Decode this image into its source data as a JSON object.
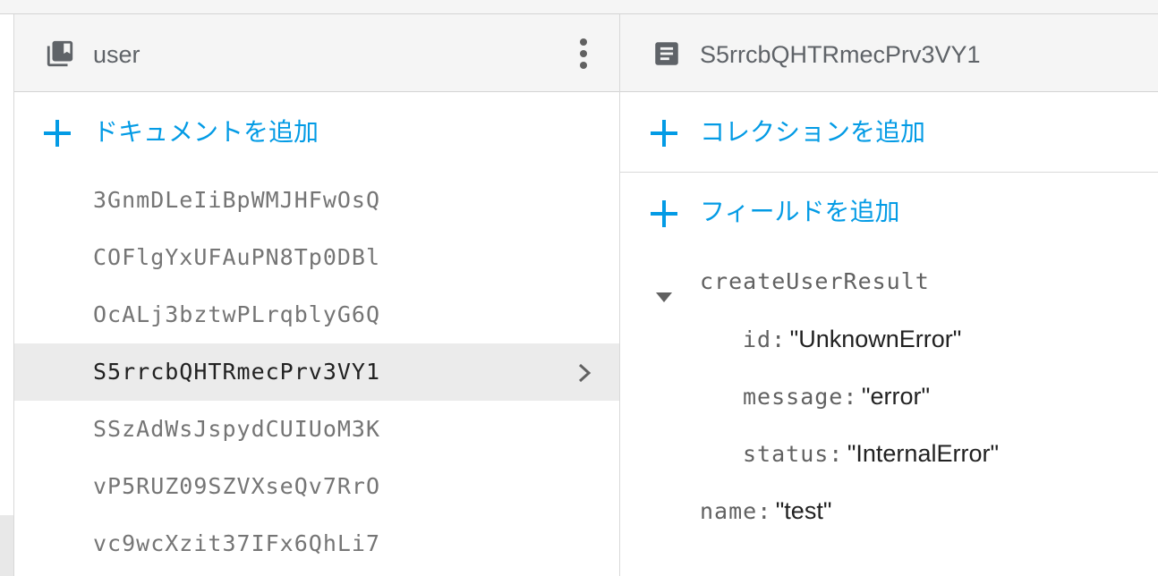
{
  "collection": {
    "name": "user",
    "add_document_label": "ドキュメントを追加",
    "documents": [
      "3GnmDLeIiBpWMJHFwOsQ",
      "COFlgYxUFAuPN8Tp0DBl",
      "OcALj3bztwPLrqblyG6Q",
      "S5rrcbQHTRmecPrv3VY1",
      "SSzAdWsJspydCUIUoM3K",
      "vP5RUZ09SZVXseQv7RrO",
      "vc9wcXzit37IFx6QhLi7"
    ],
    "selected_index": 3
  },
  "document": {
    "id": "S5rrcbQHTRmecPrv3VY1",
    "add_collection_label": "コレクションを追加",
    "add_field_label": "フィールドを追加",
    "fields": {
      "map_key": "createUserResult",
      "id_key": "id:",
      "id_value": "\"UnknownError\"",
      "message_key": "message:",
      "message_value": "\"error\"",
      "status_key": "status:",
      "status_value": "\"InternalError\"",
      "name_key": "name:",
      "name_value": "\"test\""
    }
  },
  "icons": {
    "collection": "collection-icon",
    "document": "document-icon",
    "more": "more-vert-icon",
    "add": "add-icon",
    "chevron": "chevron-right-icon",
    "expand": "expand-triangle-icon"
  },
  "colors": {
    "accent": "#039be5",
    "selected_row": "#ebebeb"
  }
}
